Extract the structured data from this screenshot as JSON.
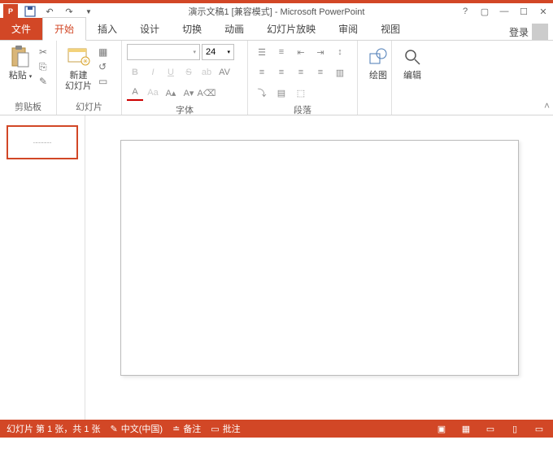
{
  "app": {
    "title": "演示文稿1 [兼容模式] - Microsoft PowerPoint",
    "login": "登录"
  },
  "tabs": {
    "file": "文件",
    "home": "开始",
    "insert": "插入",
    "design": "设计",
    "transitions": "切换",
    "animations": "动画",
    "slideshow": "幻灯片放映",
    "review": "审阅",
    "view": "视图"
  },
  "ribbon": {
    "clipboard": {
      "label": "剪贴板",
      "paste": "粘贴"
    },
    "slides": {
      "label": "幻灯片",
      "new_slide": "新建\n幻灯片"
    },
    "font": {
      "label": "字体",
      "size": "24"
    },
    "paragraph": {
      "label": "段落"
    },
    "drawing": {
      "label": "绘图"
    },
    "editing": {
      "label": "编辑"
    }
  },
  "status": {
    "slide_info": "幻灯片 第 1 张，共 1 张",
    "language": "中文(中国)",
    "notes": "备注",
    "comments": "批注"
  },
  "thumb_text": "................"
}
